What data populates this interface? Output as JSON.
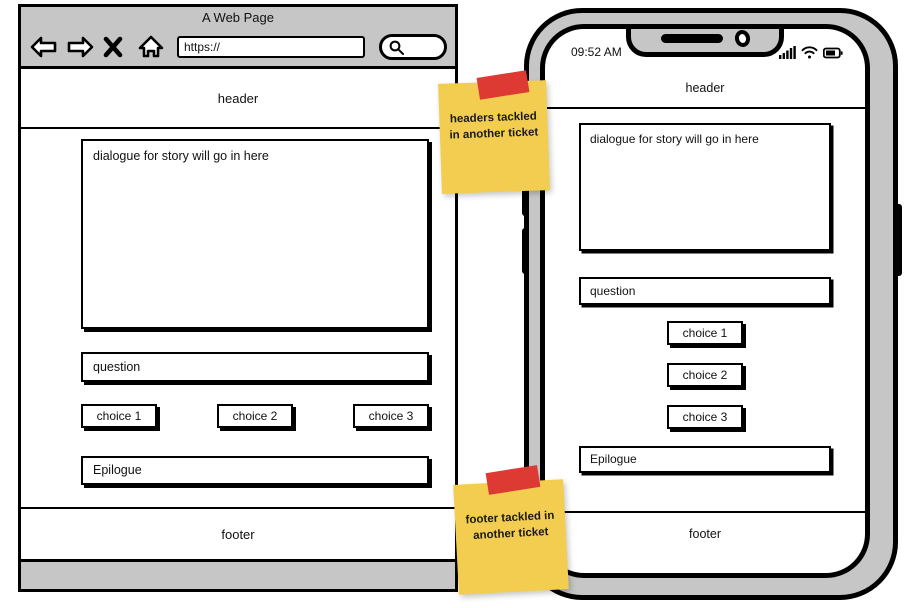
{
  "browser": {
    "title": "A Web Page",
    "nav": {
      "back_icon": "back-arrow-icon",
      "forward_icon": "forward-arrow-icon",
      "stop_icon": "close-x-icon",
      "home_icon": "home-icon",
      "search_icon": "search-icon"
    },
    "url_value": "https://",
    "page": {
      "header_label": "header",
      "dialogue_text": "dialogue for story will go in here",
      "question_label": "question",
      "choices": [
        "choice 1",
        "choice 2",
        "choice 3"
      ],
      "epilogue_label": "Epilogue",
      "footer_label": "footer"
    }
  },
  "phone": {
    "status": {
      "time": "09:52 AM",
      "signal_icon": "cellular-signal-icon",
      "wifi_icon": "wifi-icon",
      "battery_icon": "battery-icon"
    },
    "page": {
      "header_label": "header",
      "dialogue_text": "dialogue for story will go in here",
      "question_label": "question",
      "choices": [
        "choice 1",
        "choice 2",
        "choice 3"
      ],
      "epilogue_label": "Epilogue",
      "footer_label": "footer"
    }
  },
  "annotations": [
    {
      "id": "headers-note",
      "text": "headers tackled in another ticket"
    },
    {
      "id": "footer-note",
      "text": "footer tackled in another ticket"
    }
  ],
  "colors": {
    "sticky_yellow": "#f2cd4f",
    "tape_red": "#dc3a32",
    "chrome_gray": "#c6c6c6",
    "ink_black": "#000000",
    "paper_white": "#ffffff"
  }
}
